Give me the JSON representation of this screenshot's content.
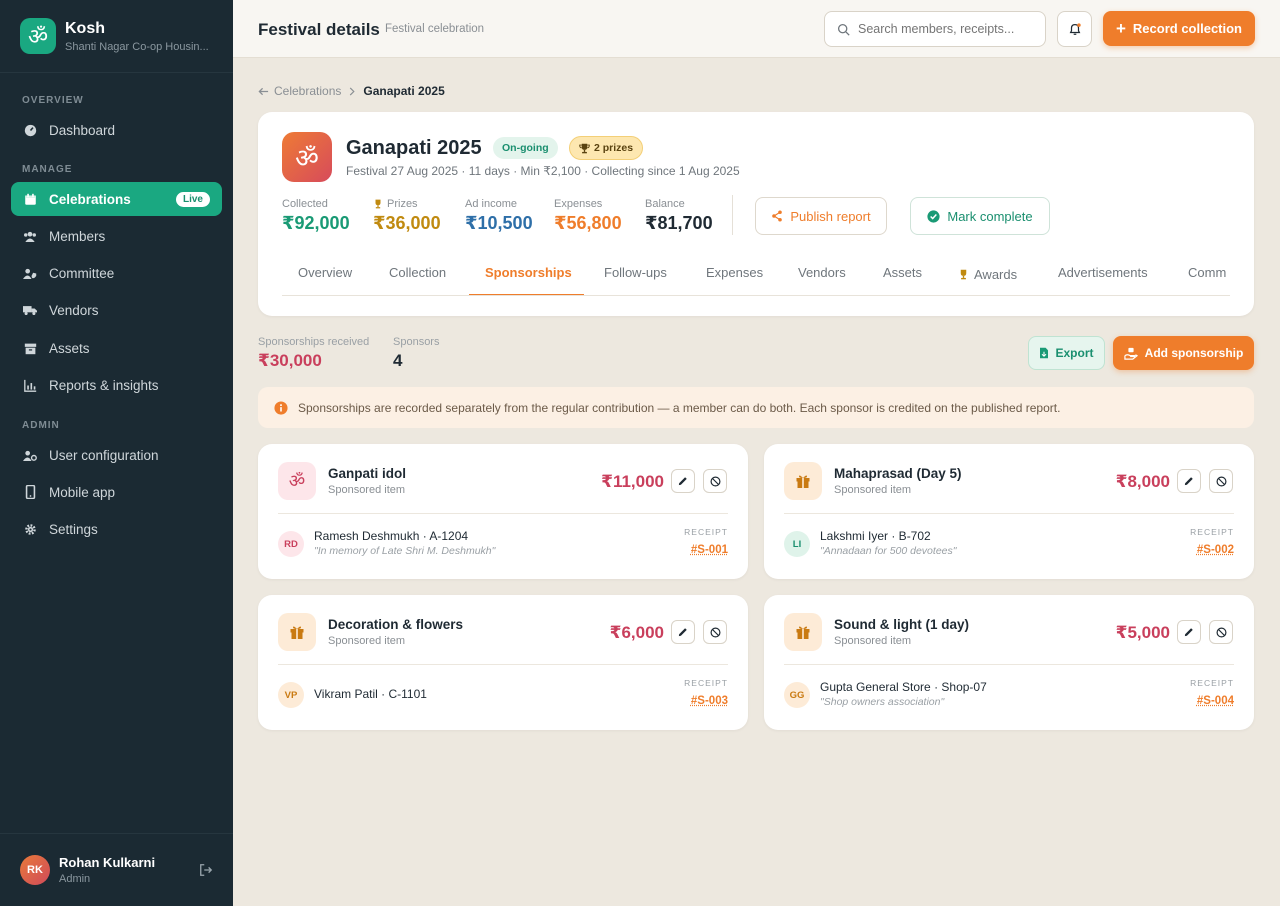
{
  "brand": {
    "name": "Kosh",
    "subtitle": "Shanti Nagar Co-op Housin...",
    "logo_glyph": "ॐ"
  },
  "sidebar": {
    "sections": {
      "overview": "OVERVIEW",
      "manage": "MANAGE",
      "admin": "ADMIN"
    },
    "items": [
      {
        "label": "Dashboard",
        "icon": "gauge-icon"
      },
      {
        "label": "Celebrations",
        "icon": "calendar-icon",
        "badge": "Live",
        "active": true
      },
      {
        "label": "Members",
        "icon": "users-icon"
      },
      {
        "label": "Committee",
        "icon": "user-shield-icon"
      },
      {
        "label": "Vendors",
        "icon": "truck-icon"
      },
      {
        "label": "Assets",
        "icon": "archive-icon"
      },
      {
        "label": "Reports & insights",
        "icon": "chart-icon"
      },
      {
        "label": "User configuration",
        "icon": "user-gear-icon"
      },
      {
        "label": "Mobile app",
        "icon": "mobile-icon"
      },
      {
        "label": "Settings",
        "icon": "gear-icon"
      }
    ]
  },
  "user": {
    "initials": "RK",
    "name": "Rohan Kulkarni",
    "role": "Admin"
  },
  "header": {
    "title": "Festival details",
    "subtitle": "Festival celebration",
    "search_placeholder": "Search members, receipts...",
    "record_label": "Record collection"
  },
  "breadcrumb": {
    "parent": "Celebrations",
    "current": "Ganapati 2025"
  },
  "festival": {
    "glyph": "ॐ",
    "name": "Ganapati 2025",
    "status": "On-going",
    "prizes_badge": "2 prizes",
    "meta": "Festival 27 Aug 2025 · 11 days · Min ₹2,100 · Collecting since 1 Aug 2025",
    "stats": [
      {
        "label": "Collected",
        "value": "₹92,000",
        "color": "#1a9a75"
      },
      {
        "label": "Prizes",
        "value": "₹36,000",
        "color": "#c08a10"
      },
      {
        "label": "Ad income",
        "value": "₹10,500",
        "color": "#2e6fa8"
      },
      {
        "label": "Expenses",
        "value": "₹56,800",
        "color": "#ef7d2b"
      },
      {
        "label": "Balance",
        "value": "₹81,700",
        "color": "#1f2a33"
      }
    ],
    "publish_label": "Publish report",
    "complete_label": "Mark complete",
    "tabs": [
      "Overview",
      "Collection",
      "Sponsorships",
      "Follow-ups",
      "Expenses",
      "Vendors",
      "Assets",
      "Awards",
      "Advertisements",
      "Comm"
    ],
    "active_tab": "Sponsorships"
  },
  "summary": {
    "received_label": "Sponsorships received",
    "received_value": "₹30,000",
    "sponsors_label": "Sponsors",
    "sponsors_value": "4",
    "export_label": "Export",
    "add_label": "Add sponsorship"
  },
  "info_text": "Sponsorships are recorded separately from the regular contribution — a member can do both. Each sponsor is credited on the published report.",
  "receipt_label": "RECEIPT",
  "sponsorships": [
    {
      "title": "Ganpati idol",
      "sub": "Sponsored item",
      "amount": "₹11,000",
      "initials": "RD",
      "person": "Ramesh Deshmukh · A-1204",
      "note": "\"In memory of Late Shri M. Deshmukh\"",
      "receipt": "#S-001",
      "icon": "om-icon"
    },
    {
      "title": "Mahaprasad (Day 5)",
      "sub": "Sponsored item",
      "amount": "₹8,000",
      "initials": "LI",
      "person": "Lakshmi Iyer · B-702",
      "note": "\"Annadaan for 500 devotees\"",
      "receipt": "#S-002",
      "icon": "gift-icon"
    },
    {
      "title": "Decoration & flowers",
      "sub": "Sponsored item",
      "amount": "₹6,000",
      "initials": "VP",
      "person": "Vikram Patil · C-1101",
      "note": "",
      "receipt": "#S-003",
      "icon": "gift-icon"
    },
    {
      "title": "Sound & light (1 day)",
      "sub": "Sponsored item",
      "amount": "₹5,000",
      "initials": "GG",
      "person": "Gupta General Store · Shop-07",
      "note": "\"Shop owners association\"",
      "receipt": "#S-004",
      "icon": "gift-icon"
    }
  ]
}
